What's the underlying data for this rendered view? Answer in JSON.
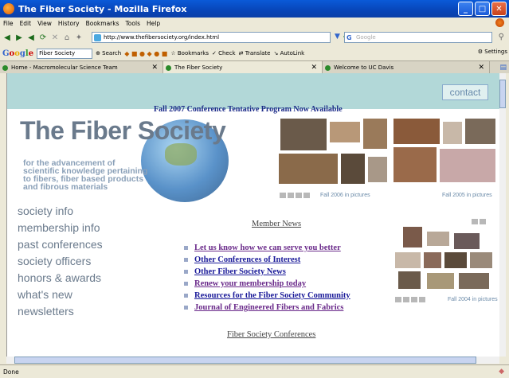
{
  "window": {
    "title": "The Fiber Society - Mozilla Firefox",
    "buttons": [
      "minimize",
      "maximize",
      "close"
    ]
  },
  "menubar": {
    "items": [
      "File",
      "Edit",
      "View",
      "History",
      "Bookmarks",
      "Tools",
      "Help"
    ]
  },
  "navbar": {
    "url": "http://www.thefibersociety.org/index.html",
    "search_placeholder": "Google"
  },
  "google_toolbar": {
    "logo": "Google",
    "search_value": "Fiber Society",
    "items": [
      "Search",
      "Bookmarks",
      "Check",
      "Translate",
      "AutoLink"
    ],
    "settings": "Settings"
  },
  "tabs": [
    {
      "label": "Home - Macromolecular Science Team",
      "active": false
    },
    {
      "label": "The Fiber Society",
      "active": true
    },
    {
      "label": "Welcome to UC Davis",
      "active": false
    }
  ],
  "page": {
    "contact": "contact",
    "headline": "Fall 2007 Conference Tentative Program Now Available",
    "logo_title": "The Fiber Society",
    "tagline": "for the advancement of scientific knowledge pertaining to fibers, fiber based products and fibrous materials",
    "nav": [
      "society info",
      "membership info",
      "past conferences",
      "society officers",
      "honors & awards",
      "what's new",
      "newsletters"
    ],
    "member_news_title": "Member News",
    "news_links": [
      {
        "label": "Let us know how we can serve you better",
        "visited": true
      },
      {
        "label": "Other Conferences of Interest",
        "visited": false
      },
      {
        "label": "Other Fiber Society News",
        "visited": false
      },
      {
        "label": "Renew your membership today",
        "visited": true
      },
      {
        "label": "Resources for the Fiber Society Community",
        "visited": false
      },
      {
        "label": "Journal of Engineered Fibers and Fabrics",
        "visited": true
      }
    ],
    "conferences_title": "Fiber Society Conferences",
    "captions": {
      "fall2006": "Fall 2006 in pictures",
      "fall2005": "Fall 2005 in pictures",
      "fall2004": "Fall 2004 in pictures"
    }
  },
  "status": {
    "text": "Done"
  }
}
